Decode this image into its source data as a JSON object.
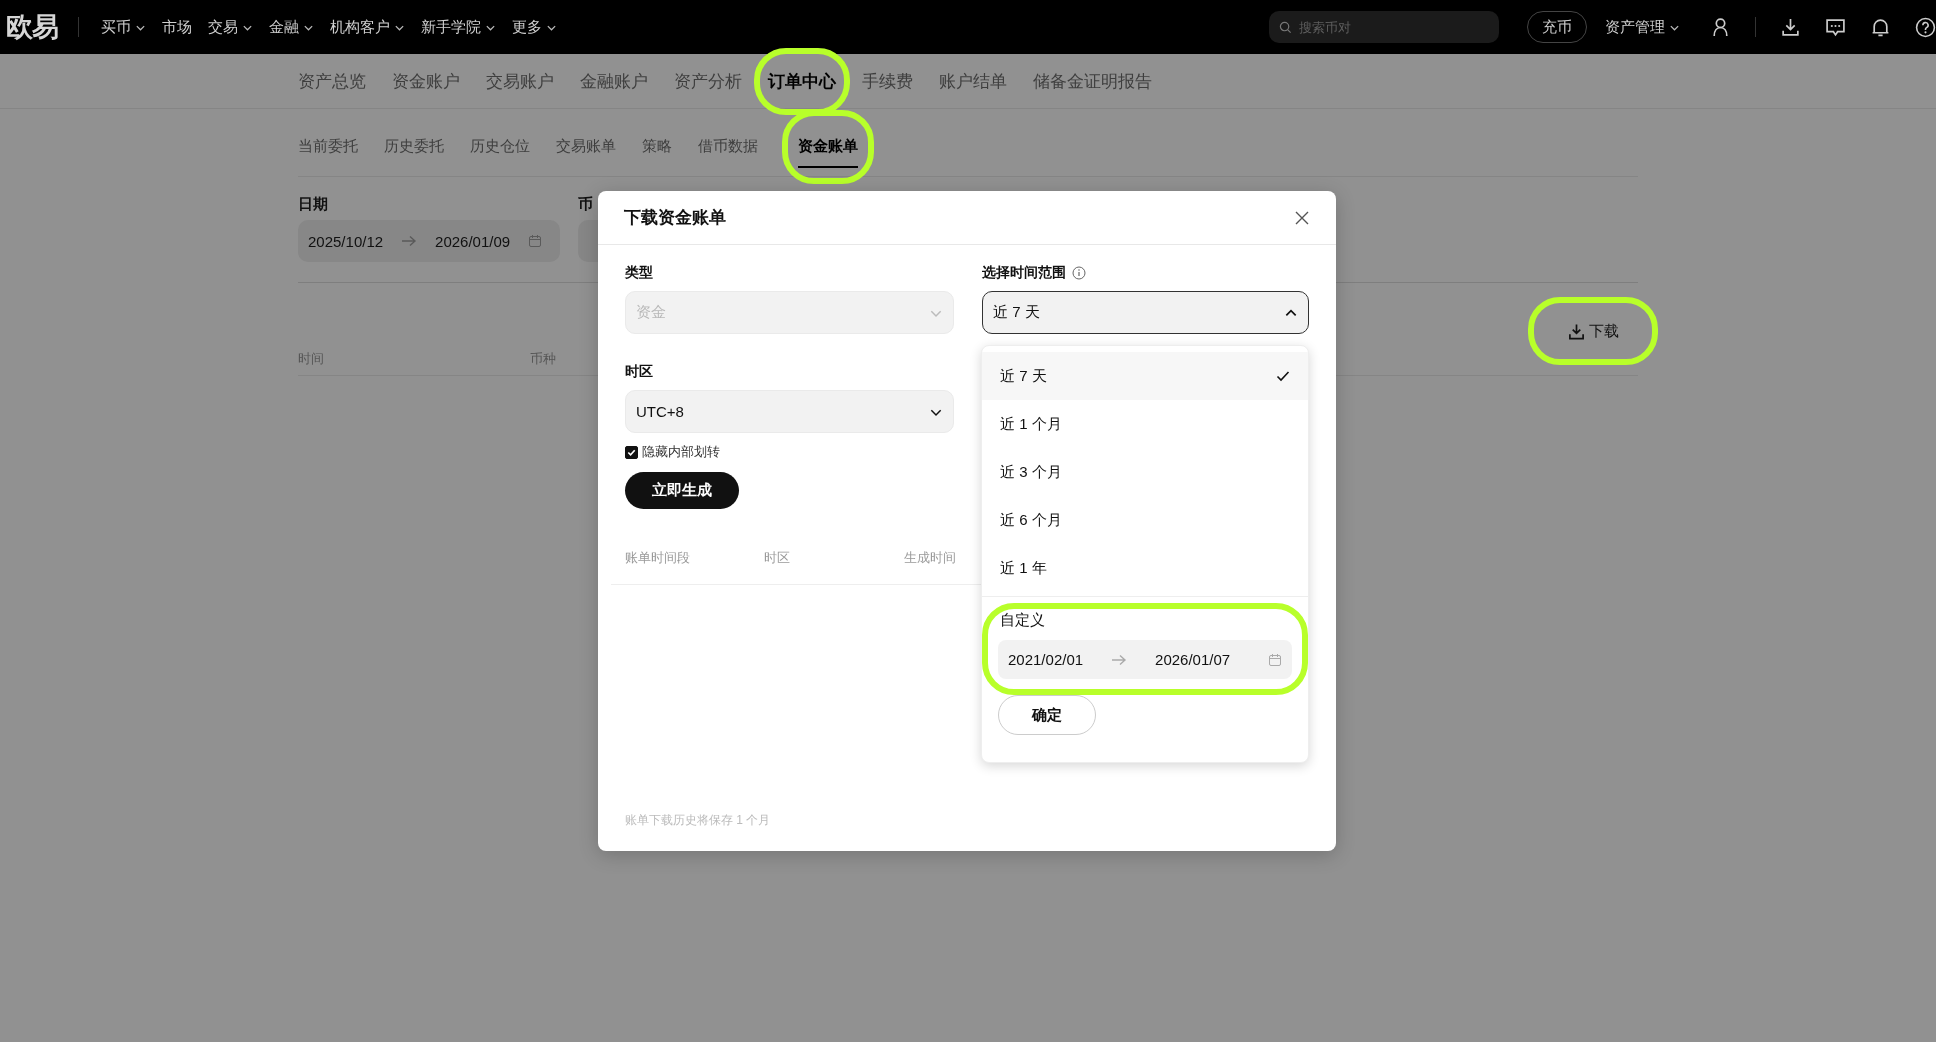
{
  "topbar": {
    "logo": "欧易",
    "nav": [
      {
        "label": "买币",
        "dropdown": true
      },
      {
        "label": "市场",
        "dropdown": false
      },
      {
        "label": "交易",
        "dropdown": true
      },
      {
        "label": "金融",
        "dropdown": true
      },
      {
        "label": "机构客户",
        "dropdown": true
      },
      {
        "label": "新手学院",
        "dropdown": true
      },
      {
        "label": "更多",
        "dropdown": true
      }
    ],
    "search": {
      "placeholder": "搜索币对"
    },
    "deposit_button": "充币",
    "asset_menu": "资产管理"
  },
  "main_tabs": [
    {
      "label": "资产总览",
      "selected": false,
      "highlighted": false
    },
    {
      "label": "资金账户",
      "selected": false,
      "highlighted": false
    },
    {
      "label": "交易账户",
      "selected": false,
      "highlighted": false
    },
    {
      "label": "金融账户",
      "selected": false,
      "highlighted": false
    },
    {
      "label": "资产分析",
      "selected": false,
      "highlighted": false
    },
    {
      "label": "订单中心",
      "selected": true,
      "highlighted": true
    },
    {
      "label": "手续费",
      "selected": false,
      "highlighted": false
    },
    {
      "label": "账户结单",
      "selected": false,
      "highlighted": false
    },
    {
      "label": "储备金证明报告",
      "selected": false,
      "highlighted": false
    }
  ],
  "sub_tabs": [
    {
      "label": "当前委托",
      "selected": false,
      "highlighted": false
    },
    {
      "label": "历史委托",
      "selected": false,
      "highlighted": false
    },
    {
      "label": "历史仓位",
      "selected": false,
      "highlighted": false
    },
    {
      "label": "交易账单",
      "selected": false,
      "highlighted": false
    },
    {
      "label": "策略",
      "selected": false,
      "highlighted": false
    },
    {
      "label": "借币数据",
      "selected": false,
      "highlighted": false
    },
    {
      "label": "资金账单",
      "selected": true,
      "highlighted": true
    }
  ],
  "filters": {
    "date_label": "日期",
    "date_from": "2025/10/12",
    "date_to": "2026/01/09",
    "currency_label": "币"
  },
  "download_button": {
    "label": "下载",
    "highlighted": true
  },
  "table": {
    "columns": [
      "时间",
      "币种"
    ]
  },
  "modal": {
    "title": "下载资金账单",
    "type_label": "类型",
    "type_select": {
      "value": "资金",
      "disabled": true
    },
    "timezone_label": "时区",
    "timezone_select": {
      "value": "UTC+8",
      "disabled": false
    },
    "hide_internal": {
      "label": "隐藏内部划转",
      "checked": true
    },
    "generate_button": "立即生成",
    "history_columns": [
      "账单时间段",
      "时区",
      "生成时间"
    ],
    "footer_note": "账单下载历史将保存 1 个月",
    "range_label": "选择时间范围",
    "range_select": {
      "value": "近 7 天",
      "expanded": true
    },
    "range_options": [
      {
        "label": "近 7 天",
        "selected": true
      },
      {
        "label": "近 1 个月",
        "selected": false
      },
      {
        "label": "近 3 个月",
        "selected": false
      },
      {
        "label": "近 6 个月",
        "selected": false
      },
      {
        "label": "近 1 年",
        "selected": false
      }
    ],
    "custom": {
      "label": "自定义",
      "from": "2021/02/01",
      "to": "2026/01/07",
      "highlighted": true
    },
    "confirm_button": "确定"
  }
}
